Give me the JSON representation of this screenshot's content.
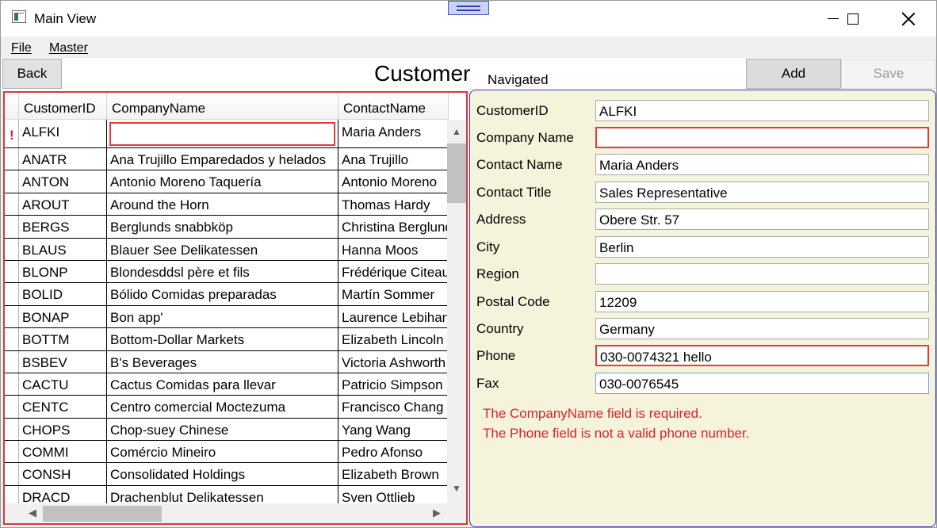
{
  "window": {
    "title": "Main View"
  },
  "menu": {
    "file": "File",
    "master": "Master"
  },
  "toolbar": {
    "back": "Back",
    "add": "Add",
    "save": "Save"
  },
  "page": {
    "title": "Customer",
    "status": "Navigated"
  },
  "grid": {
    "columns": [
      "CustomerID",
      "CompanyName",
      "ContactName"
    ],
    "error_marker": "!",
    "rows": [
      [
        "ALFKI",
        "",
        "Maria Anders"
      ],
      [
        "ANATR",
        "Ana Trujillo Emparedados y helados",
        "Ana Trujillo"
      ],
      [
        "ANTON",
        "Antonio Moreno Taquería",
        "Antonio Moreno"
      ],
      [
        "AROUT",
        "Around the Horn",
        "Thomas Hardy"
      ],
      [
        "BERGS",
        "Berglunds snabbköp",
        "Christina Berglund"
      ],
      [
        "BLAUS",
        "Blauer See Delikatessen",
        "Hanna Moos"
      ],
      [
        "BLONP",
        "Blondesddsl père et fils",
        "Frédérique Citeaux"
      ],
      [
        "BOLID",
        "Bólido Comidas preparadas",
        "Martín Sommer"
      ],
      [
        "BONAP",
        "Bon app'",
        "Laurence Lebihan"
      ],
      [
        "BOTTM",
        "Bottom-Dollar Markets",
        "Elizabeth Lincoln"
      ],
      [
        "BSBEV",
        "B's Beverages",
        "Victoria Ashworth"
      ],
      [
        "CACTU",
        "Cactus Comidas para llevar",
        "Patricio Simpson"
      ],
      [
        "CENTC",
        "Centro comercial Moctezuma",
        "Francisco Chang"
      ],
      [
        "CHOPS",
        "Chop-suey Chinese",
        "Yang Wang"
      ],
      [
        "COMMI",
        "Comércio Mineiro",
        "Pedro Afonso"
      ],
      [
        "CONSH",
        "Consolidated Holdings",
        "Elizabeth Brown"
      ],
      [
        "DRACD",
        "Drachenblut Delikatessen",
        "Sven Ottlieb"
      ]
    ]
  },
  "detail": {
    "fields": [
      {
        "label": "CustomerID",
        "value": "ALFKI"
      },
      {
        "label": "Company Name",
        "value": ""
      },
      {
        "label": "Contact Name",
        "value": "Maria Anders"
      },
      {
        "label": "Contact Title",
        "value": "Sales Representative"
      },
      {
        "label": "Address",
        "value": "Obere Str. 57"
      },
      {
        "label": "City",
        "value": "Berlin"
      },
      {
        "label": "Region",
        "value": ""
      },
      {
        "label": "Postal Code",
        "value": "12209"
      },
      {
        "label": "Country",
        "value": "Germany"
      },
      {
        "label": "Phone",
        "value": "030-0074321 hello"
      },
      {
        "label": "Fax",
        "value": "030-0076545"
      }
    ],
    "errors": [
      "The CompanyName field is required.",
      "The Phone field is not a valid phone number."
    ]
  },
  "colors": {
    "error": "#e0202d",
    "detail_border": "#3434c8",
    "detail_bg": "#f5f3dc",
    "grid_border": "#d43b3b"
  }
}
